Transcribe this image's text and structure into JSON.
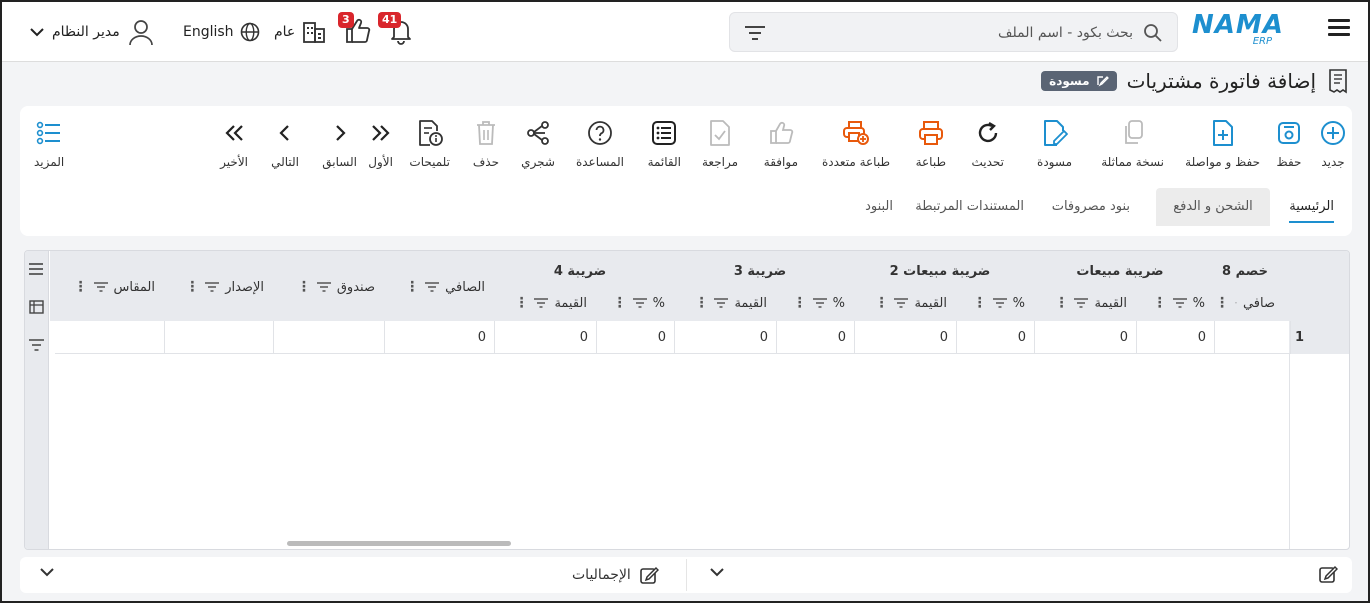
{
  "topbar": {
    "search_placeholder": "بحث بكود - اسم الملف",
    "logo_main": "NAMA",
    "logo_sub": "ERP",
    "notifications_count": "41",
    "likes_count": "3",
    "company_label": "عام",
    "language_label": "English",
    "user_label": "مدير النظام"
  },
  "page": {
    "title": "إضافة فاتورة مشتريات",
    "status_badge": "مسودة"
  },
  "toolbar": {
    "new": "جديد",
    "save": "حفظ",
    "save_continue": "حفظ و مواصلة",
    "clone": "نسخة مماثلة",
    "draft": "مسودة",
    "refresh": "تحديث",
    "print": "طباعة",
    "multi_print": "طباعة متعددة",
    "approve": "موافقة",
    "review": "مراجعة",
    "list": "القائمة",
    "help": "المساعدة",
    "tree": "شجري",
    "delete": "حذف",
    "hints": "تلميحات",
    "first": "الأول",
    "previous": "السابق",
    "next": "التالي",
    "last": "الأخير",
    "more": "المزيد"
  },
  "tabs": [
    "الرئيسية",
    "الشحن و الدفع",
    "بنود مصروفات",
    "المستندات المرتبطة",
    "البنود"
  ],
  "grid": {
    "group_headers": [
      "خصم 8",
      "ضريبة مبيعات",
      "ضريبة مبيعات 2",
      "ضريبة 3",
      "ضريبة 4"
    ],
    "sub_headers": [
      "صافي",
      "%",
      "القيمة",
      "%",
      "القيمة",
      "%",
      "القيمة",
      "%",
      "القيمة"
    ],
    "single_headers": [
      "الصافي",
      "صندوق",
      "الإصدار",
      "المقاس"
    ],
    "row_number": "1",
    "row_values": [
      "0",
      "0",
      "0",
      "0",
      "0",
      "0",
      "0",
      "0",
      "0",
      "",
      "",
      ""
    ]
  },
  "bottom": {
    "totals_label": "الإجماليات"
  },
  "colors": {
    "accent": "#1d8fcf",
    "print_orange": "#e8590c",
    "badge_red": "#d9262c",
    "draft_badge_bg": "#5a6474"
  }
}
